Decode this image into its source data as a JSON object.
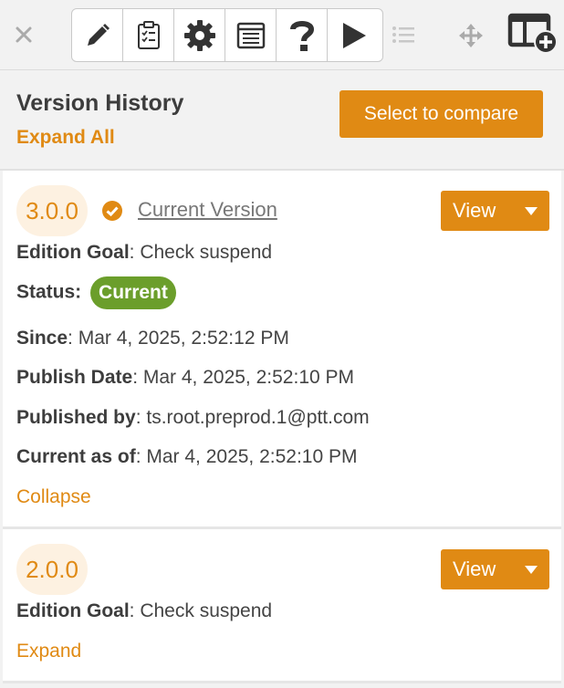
{
  "toolbar": {
    "icons": [
      "close-icon",
      "pencil-icon",
      "clipboard-checklist-icon",
      "gear-icon",
      "form-icon",
      "help-icon",
      "play-icon",
      "list-icon",
      "move-icon",
      "add-panel-icon"
    ]
  },
  "header": {
    "title": "Version History",
    "expand_all": "Expand All",
    "compare_button": "Select to compare"
  },
  "versions": [
    {
      "version": "3.0.0",
      "current_link": "Current Version",
      "view_label": "View",
      "edition_goal_label": "Edition Goal",
      "edition_goal": ": Check suspend",
      "status_label": "Status:",
      "status": "Current",
      "since_label": "Since",
      "since": ": Mar 4, 2025, 2:52:12 PM",
      "publish_label": "Publish Date",
      "publish": ": Mar 4, 2025, 2:52:10 PM",
      "published_by_label": "Published by",
      "published_by": ": ts.root.preprod.1@ptt.com",
      "current_as_of_label": "Current as of",
      "current_as_of": ": Mar 4, 2025, 2:52:10 PM",
      "toggle": "Collapse"
    },
    {
      "version": "2.0.0",
      "view_label": "View",
      "edition_goal_label": "Edition Goal",
      "edition_goal": ": Check suspend",
      "toggle": "Expand"
    }
  ],
  "colors": {
    "accent": "#e08a14",
    "status_green": "#6b9e2b"
  }
}
